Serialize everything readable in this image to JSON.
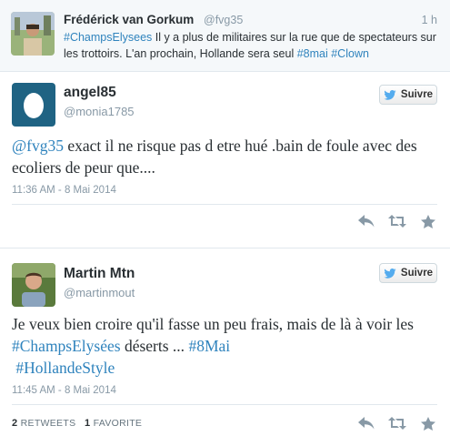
{
  "parent_tweet": {
    "name": "Frédérick van Gorkum",
    "handle": "@fvg35",
    "time": "1 h",
    "text_hashtag1": "#ChampsElysees",
    "text_main": " Il y a plus de militaires sur la rue que de spectateurs sur les trottoirs. L'an prochain, Hollande sera seul ",
    "text_hashtag2": "#8mai",
    "text_hashtag3": "#Clown"
  },
  "tweets": [
    {
      "name": "angel85",
      "handle": "@monia1785",
      "follow_label": "Suivre",
      "mention": "@fvg35",
      "text": " exact il ne risque pas d etre hué .bain de foule avec des ecoliers de peur que....",
      "date": "11:36 AM - 8 Mai 2014"
    },
    {
      "name": "Martin Mtn",
      "handle": "@martinmout",
      "follow_label": "Suivre",
      "text_a": "Je veux bien croire qu'il fasse un peu frais, mais de là à voir les ",
      "hashtag1": "#ChampsElysées",
      "text_b": " déserts ... ",
      "hashtag2": "#8Mai",
      "hashtag3": "#HollandeStyle",
      "date": "11:45 AM - 8 Mai 2014",
      "retweets_count": "2",
      "retweets_label": "RETWEETS",
      "favorites_count": "1",
      "favorites_label": "FAVORITE"
    }
  ],
  "colors": {
    "link": "#2f83bd",
    "twitter_bird": "#55acee",
    "action_icon": "#8899a6"
  },
  "icons": [
    "reply-icon",
    "retweet-icon",
    "favorite-icon",
    "twitter-bird-icon"
  ]
}
